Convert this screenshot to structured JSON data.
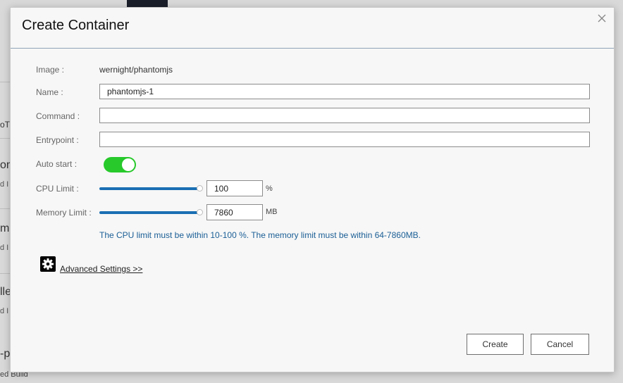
{
  "background": {
    "fragments": [
      "oT",
      "om",
      "d I",
      "m",
      "d I",
      "lle",
      "d I",
      "-pl"
    ],
    "bottom_text": "ed Build"
  },
  "dialog": {
    "title": "Create Container",
    "fields": {
      "image": {
        "label": "Image :",
        "value": "wernight/phantomjs"
      },
      "name": {
        "label": "Name :",
        "value": "phantomjs-1",
        "placeholder": ""
      },
      "command": {
        "label": "Command :",
        "value": "",
        "placeholder": ""
      },
      "entrypoint": {
        "label": "Entrypoint :",
        "value": "",
        "placeholder": ""
      },
      "auto_start": {
        "label": "Auto start :",
        "enabled": true
      },
      "cpu_limit": {
        "label": "CPU Limit :",
        "value": "100",
        "unit": "%",
        "slider_level": 1.0
      },
      "memory_limit": {
        "label": "Memory Limit :",
        "value": "7860",
        "unit": "MB",
        "slider_level": 1.0
      }
    },
    "hint": "The CPU limit must be within 10-100 %. The memory limit must be within 64-7860MB.",
    "advanced_link": "Advanced Settings >>",
    "buttons": {
      "create": "Create",
      "cancel": "Cancel"
    }
  },
  "colors": {
    "toggle_on": "#27c92b",
    "slider": "#1a6fb3",
    "hint_text": "#1a5e95"
  }
}
